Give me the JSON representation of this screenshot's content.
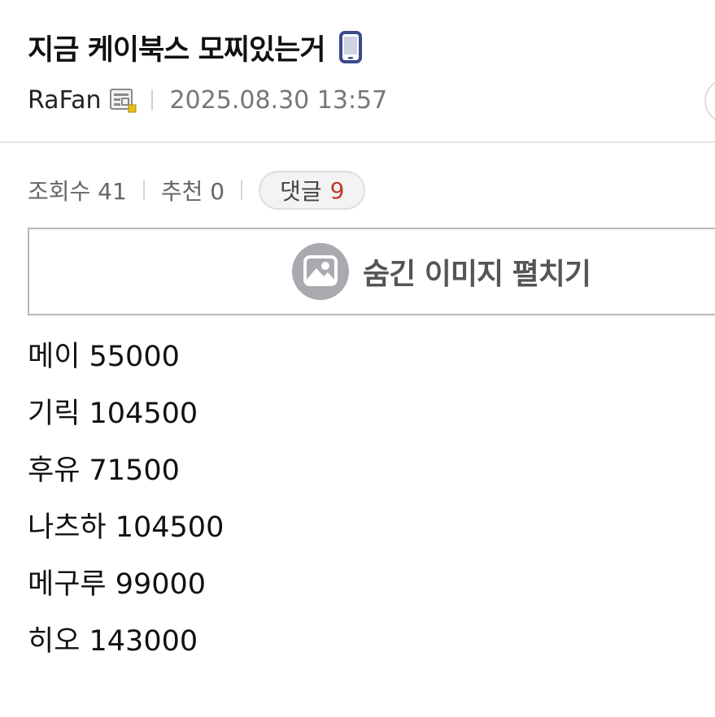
{
  "post": {
    "title": "지금 케이북스 모찌있는거",
    "device_icon": "smartphone-icon",
    "author": "RaFan",
    "author_level_icon": "level-badge-icon",
    "date": "2025.08.30 13:57"
  },
  "stats": {
    "views": "조회수 41",
    "recommend": "추천 0",
    "comments_label": "댓글",
    "comments_count": "9"
  },
  "hidden_image": {
    "icon": "image-icon",
    "label": "숨긴 이미지 펼치기"
  },
  "content_lines": [
    "메이 55000",
    "기릭 104500",
    "후유 71500",
    "나츠하 104500",
    "메구루 99000",
    "히오 143000"
  ],
  "colors": {
    "accent_count": "#c0392b",
    "device_icon": "#3b4a8a",
    "image_icon_bg": "#a9a9b0"
  }
}
